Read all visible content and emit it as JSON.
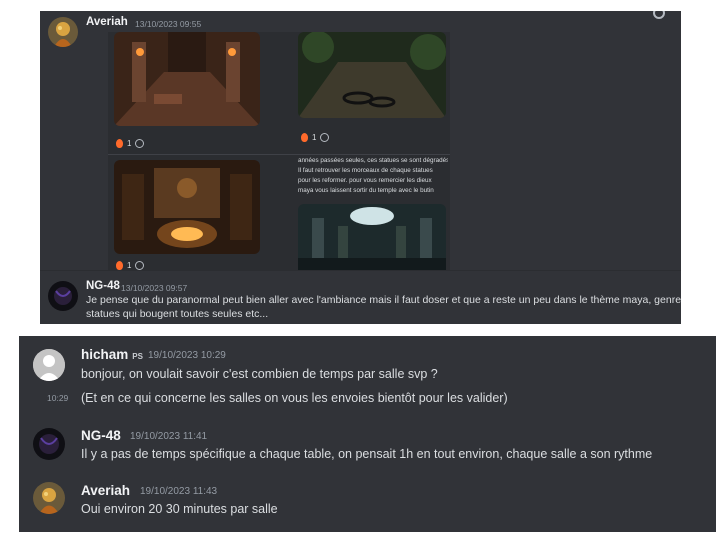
{
  "top": {
    "msg1": {
      "author": "Averiah",
      "timestamp": "13/10/2023 09:55",
      "reactions": [
        {
          "count": "1"
        },
        {
          "count": "1"
        },
        {
          "count": "1"
        }
      ],
      "caption_lines": [
        "années passées seules, ces statues se sont dégradés.",
        "Il faut retrouver les morceaux de chaque statues",
        "pour les reformer. pour vous remercier les dieux",
        "maya vous laissent sortir du temple avec le butin"
      ]
    },
    "msg2": {
      "author": "NG-48",
      "timestamp": "13/10/2023 09:57",
      "text_line1": "Je pense que du paranormal peut bien aller avec l'ambiance mais il faut doser et que a reste un peu dans le thème maya, genre des",
      "text_line2": "statues qui bougent toutes seules etc..."
    }
  },
  "bottom": {
    "msg1": {
      "author": "hicham",
      "tag": "PS",
      "timestamp": "19/10/2023 10:29",
      "text": "bonjour, on voulait savoir c'est combien de temps par salle svp ?"
    },
    "msg1b": {
      "time": "10:29",
      "text": "(Et en ce qui concerne les salles on vous les envoies bientôt pour les valider)"
    },
    "msg2": {
      "author": "NG-48",
      "timestamp": "19/10/2023 11:41",
      "text": "Il y a pas de temps spécifique a chaque table, on pensait 1h en tout environ, chaque salle a son rythme"
    },
    "msg3": {
      "author": "Averiah",
      "timestamp": "19/10/2023 11:43",
      "text": "Oui environ 20 30 minutes par salle"
    }
  }
}
